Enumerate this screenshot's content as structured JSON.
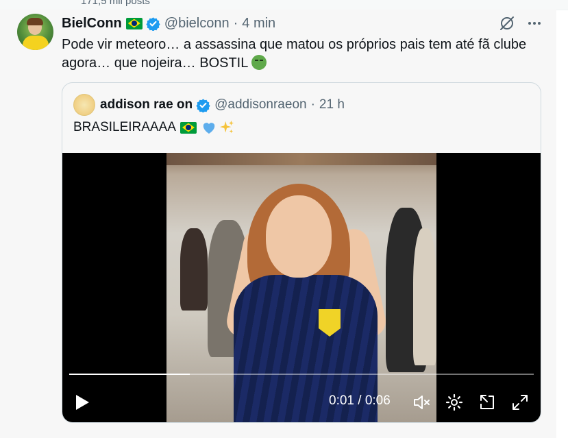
{
  "top_strip": {
    "posts_text": "171,5 mil posts"
  },
  "tweet": {
    "author_name": "BielConn",
    "handle": "@bielconn",
    "separator": "·",
    "time": "4 min",
    "text": "Pode vir meteoro… a assassina que matou os próprios pais tem até fã clube agora… que nojeira… BOSTIL",
    "icons": [
      "grok-icon",
      "more-icon"
    ]
  },
  "quoted": {
    "author_name": "addison rae on",
    "handle": "@addisonraeon",
    "separator": "·",
    "time": "21 h",
    "text": "BRASILEIRAAAA",
    "video": {
      "current_time": "0:01",
      "duration": "0:06",
      "time_separator": " / ",
      "progress_fraction": 0.26,
      "controls": [
        "play-icon",
        "mute-icon",
        "settings-icon",
        "popout-icon",
        "fullscreen-icon"
      ]
    }
  },
  "colors": {
    "accent": "#1d9bf0",
    "text": "#0f1419",
    "secondary": "#536471",
    "border": "#cfd9de"
  }
}
